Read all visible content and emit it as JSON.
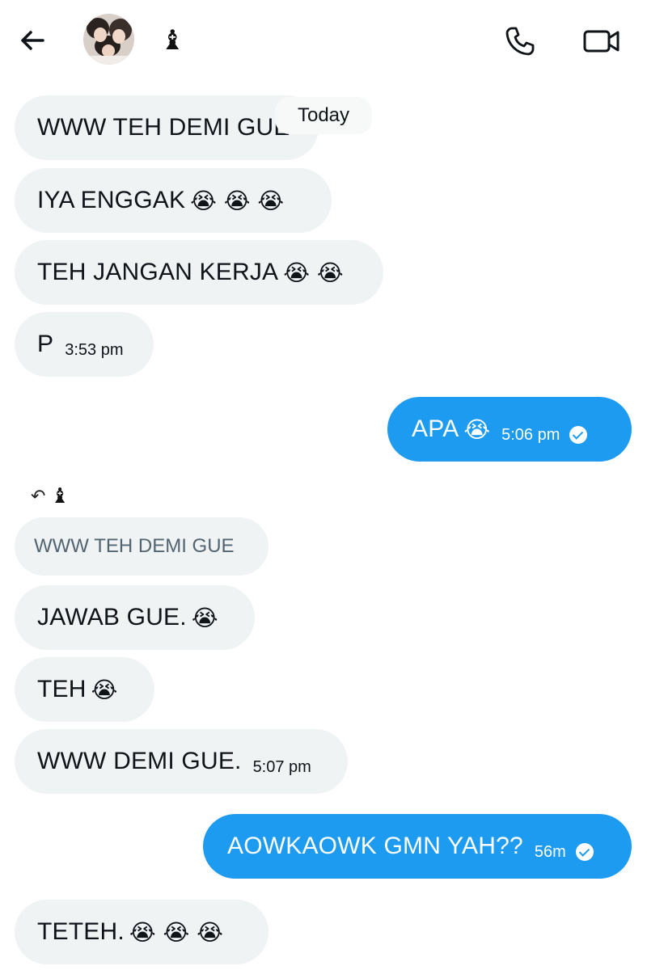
{
  "header": {
    "contact_glyph": "♝",
    "back_icon": "arrow-left-icon",
    "call_icon": "phone-icon",
    "video_icon": "video-camera-icon"
  },
  "date_separator": "Today",
  "messages": [
    {
      "text": "WWW TEH DEMI GUE",
      "emoji": "",
      "time": ""
    },
    {
      "text": "IYA ENGGAK",
      "emoji": "😭 😭 😭",
      "time": ""
    },
    {
      "text": "TEH JANGAN KERJA",
      "emoji": "😭 😭",
      "time": ""
    },
    {
      "text": "P",
      "emoji": "",
      "time": "3:53 pm"
    },
    {
      "text": "APA",
      "emoji": "😭",
      "time": "5:06 pm"
    },
    {
      "text": "JAWAB GUE.",
      "emoji": "😭",
      "time": ""
    },
    {
      "text": "TEH",
      "emoji": "😭",
      "time": ""
    },
    {
      "text": "WWW DEMI GUE.",
      "emoji": "",
      "time": "5:07 pm"
    },
    {
      "text": "AOWKAOWK GMN YAH??",
      "emoji": "",
      "time": "56m"
    },
    {
      "text": "TETEH.",
      "emoji": "😭 😭 😭",
      "time": ""
    }
  ],
  "reply": {
    "arrow": "↶",
    "glyph": "♝",
    "quoted_text": "WWW TEH DEMI GUE"
  },
  "colors": {
    "outgoing_bubble": "#1d9bf0",
    "incoming_bubble": "#eff3f4",
    "text": "#0f1419"
  }
}
